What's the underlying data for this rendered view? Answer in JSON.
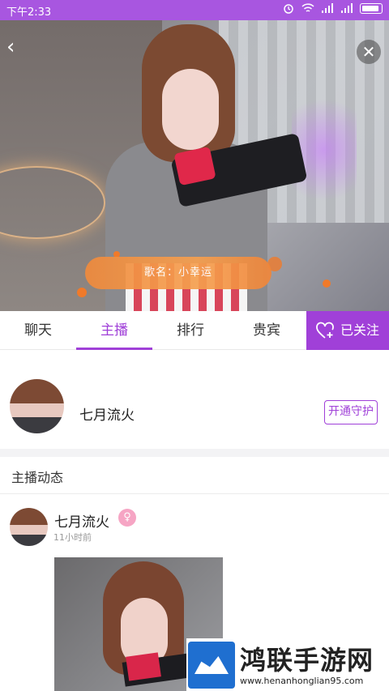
{
  "status_bar": {
    "time": "下午2:33",
    "icons": [
      "alarm-icon",
      "wifi-icon",
      "signal-icon",
      "signal-icon",
      "battery-icon"
    ]
  },
  "player": {
    "back_icon": "back-chevron-icon",
    "close_icon": "close-icon",
    "song_banner": "歌名：小幸运"
  },
  "tabs": [
    {
      "label": "聊天",
      "active": false
    },
    {
      "label": "主播",
      "active": true
    },
    {
      "label": "排行",
      "active": false
    },
    {
      "label": "贵宾",
      "active": false
    }
  ],
  "follow": {
    "label": "已关注",
    "icon": "heart-plus-icon",
    "color": "#a040d8"
  },
  "host": {
    "name": "七月流火",
    "guard_button": "开通守护"
  },
  "feed": {
    "title": "主播动态",
    "posts": [
      {
        "author": "七月流火",
        "gender_icon": "female-icon",
        "time": "11小时前"
      }
    ]
  },
  "watermark": {
    "title": "鸿联手游网",
    "url": "www.henanhonglian95.com"
  },
  "colors": {
    "accent": "#a040d8",
    "status_bar": "#a856e0",
    "banner": "#f08a3c"
  }
}
